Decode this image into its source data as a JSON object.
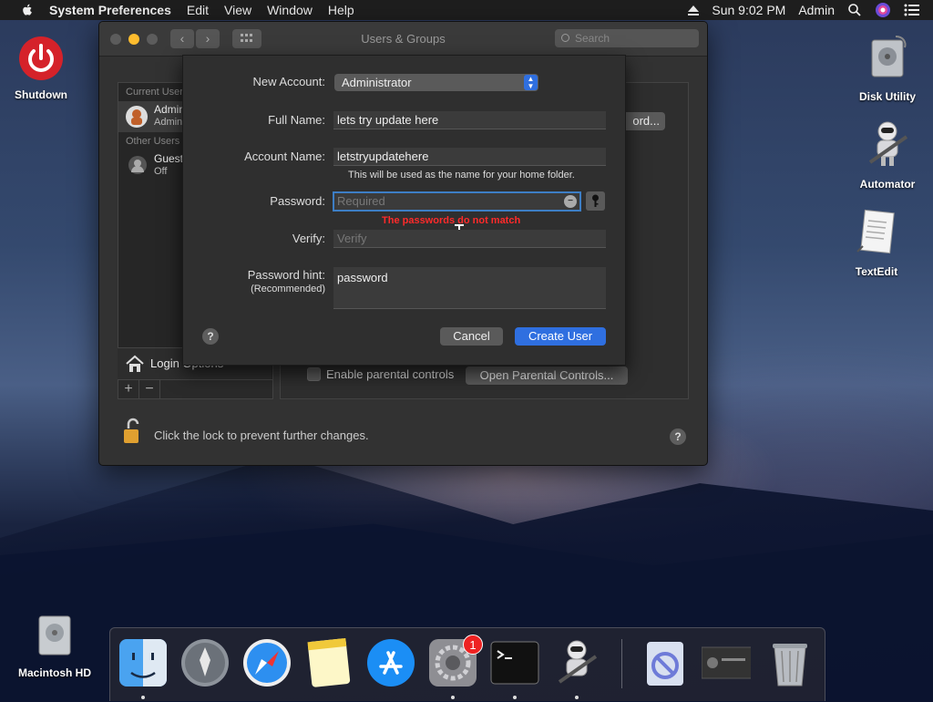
{
  "menubar": {
    "app": "System Preferences",
    "items": [
      "Edit",
      "View",
      "Window",
      "Help"
    ],
    "clock": "Sun 9:02 PM",
    "user": "Admin"
  },
  "desktop": {
    "shutdown": "Shutdown",
    "disk_utility": "Disk Utility",
    "automator": "Automator",
    "textedit": "TextEdit",
    "macintosh_hd": "Macintosh HD"
  },
  "window": {
    "title": "Users & Groups",
    "search_placeholder": "Search",
    "sidebar": {
      "current_users_header": "Current Users",
      "current_user_name": "Admin",
      "current_user_role": "Admin",
      "other_users_header": "Other Users",
      "guest_name": "Guest",
      "guest_status": "Off",
      "login_options": "Login Options"
    },
    "change_password_button": "ord...",
    "parental_controls_label": "Enable parental controls",
    "open_parental_controls_button": "Open Parental Controls...",
    "lock_text": "Click the lock to prevent further changes.",
    "help": "?"
  },
  "sheet": {
    "new_account_label": "New Account:",
    "new_account_value": "Administrator",
    "full_name_label": "Full Name:",
    "full_name_value": "lets try update here",
    "account_name_label": "Account Name:",
    "account_name_value": "letstryupdatehere",
    "account_name_hint": "This will be used as the name for your home folder.",
    "password_label": "Password:",
    "password_placeholder": "Required",
    "password_error": "The passwords do not match",
    "verify_label": "Verify:",
    "verify_placeholder": "Verify",
    "hint_label": "Password hint:",
    "hint_label_sub": "(Recommended)",
    "hint_value": "password",
    "help": "?",
    "cancel_button": "Cancel",
    "create_button": "Create User"
  },
  "dock": {
    "system_prefs_badge": "1"
  },
  "colors": {
    "accent": "#2f6fe0",
    "error": "#ff2a2a",
    "close": "#ff5f57",
    "minimize": "#febc2e",
    "zoom": "#5c5c5c"
  }
}
